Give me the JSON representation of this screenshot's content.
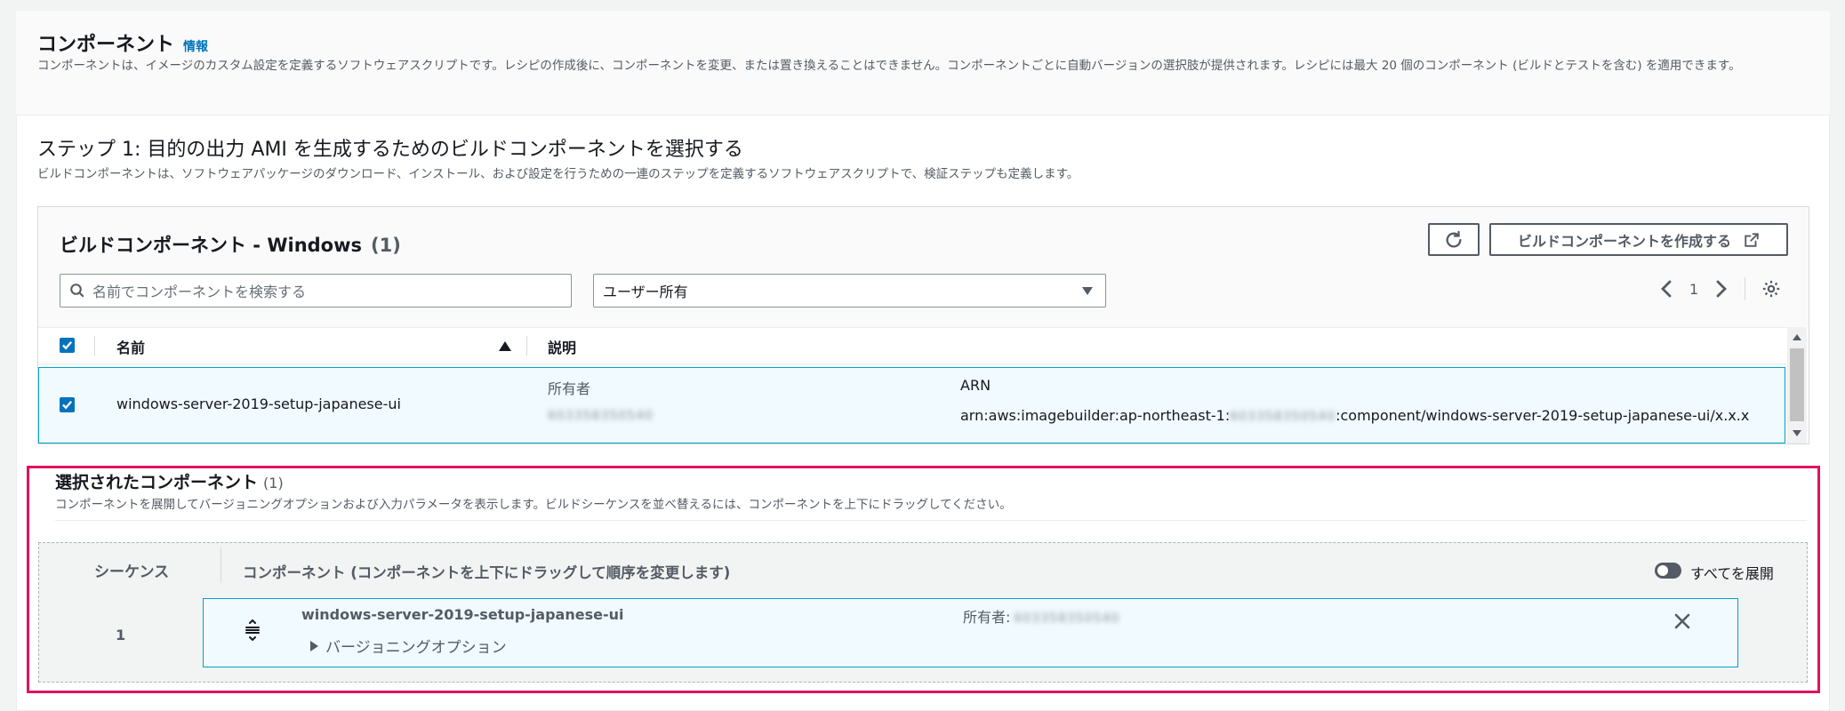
{
  "components": {
    "title": "コンポーネント",
    "info_link": "情報",
    "description": "コンポーネントは、イメージのカスタム設定を定義するソフトウェアスクリプトです。レシピの作成後に、コンポーネントを変更、または置き換えることはできません。コンポーネントごとに自動バージョンの選択肢が提供されます。レシピには最大 20 個のコンポーネント (ビルドとテストを含む) を適用できます。"
  },
  "step1": {
    "title": "ステップ 1: 目的の出力 AMI を生成するためのビルドコンポーネントを選択する",
    "description": "ビルドコンポーネントは、ソフトウェアパッケージのダウンロード、インストール、および設定を行うための一連のステップを定義するソフトウェアスクリプトで、検証ステップも定義します。"
  },
  "build_table": {
    "title": "ビルドコンポーネント - Windows",
    "count": "(1)",
    "create_button": "ビルドコンポーネントを作成する",
    "search_placeholder": "名前でコンポーネントを検索する",
    "filter_value": "ユーザー所有",
    "page_number": "1",
    "columns": {
      "name": "名前",
      "description": "説明"
    },
    "rows": [
      {
        "name": "windows-server-2019-setup-japanese-ui",
        "owner_label": "所有者",
        "owner_value": "603358350540",
        "arn_label": "ARN",
        "arn_prefix": "arn:aws:imagebuilder:ap-northeast-1:",
        "arn_account": "603358350540",
        "arn_suffix": ":component/windows-server-2019-setup-japanese-ui/x.x.x"
      }
    ]
  },
  "selected": {
    "title": "選択されたコンポーネント",
    "count": "(1)",
    "description": "コンポーネントを展開してバージョニングオプションおよび入力パラメータを表示します。ビルドシーケンスを並べ替えるには、コンポーネントを上下にドラッグしてください。",
    "sequence_header": "シーケンス",
    "component_header": "コンポーネント (コンポーネントを上下にドラッグして順序を変更します)",
    "expand_all_label": "すべてを展開",
    "items": [
      {
        "sequence": "1",
        "name": "windows-server-2019-setup-japanese-ui",
        "owner_label": "所有者:",
        "owner_value": "603358350540",
        "versioning_label": "バージョニングオプション"
      }
    ]
  },
  "colors": {
    "accent": "#0073bb",
    "highlight_border": "#e0115f",
    "selected_row_bg": "#f1faff"
  }
}
